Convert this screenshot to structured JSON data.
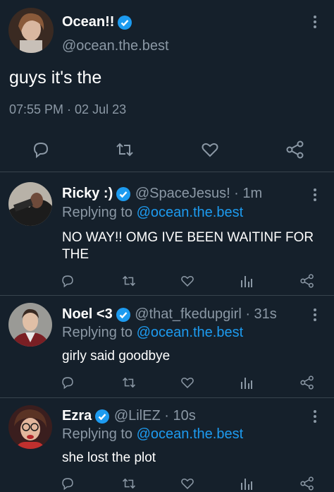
{
  "main_tweet": {
    "display_name": "Ocean!!",
    "handle": "@ocean.the.best",
    "text": "guys it's the",
    "timestamp": "07:55 PM · 02 Jul 23",
    "verified": true,
    "actions": [
      "reply-icon",
      "retweet-icon",
      "like-icon",
      "share-icon"
    ]
  },
  "replies": [
    {
      "display_name": "Ricky :)",
      "meta": "@SpaceJesus! · 1m",
      "replying_prefix": "Replying to",
      "replying_to": "@ocean.the.best",
      "text": "NO WAY!! OMG IVE BEEN WAITINF FOR THE",
      "verified": true
    },
    {
      "display_name": "Noel <3",
      "meta": "@that_fkedupgirl · 31s",
      "replying_prefix": "Replying to",
      "replying_to": "@ocean.the.best",
      "text": "girly said goodbye",
      "verified": true
    },
    {
      "display_name": "Ezra",
      "meta": "@LilEZ · 10s",
      "replying_prefix": "Replying to",
      "replying_to": "@ocean.the.best",
      "text": "she lost the plot",
      "verified": true
    }
  ],
  "colors": {
    "background": "#15202b",
    "divider": "#38444d",
    "secondary_text": "#8b98a5",
    "link": "#1d9bf0",
    "verified_badge": "#1d9bf0"
  }
}
